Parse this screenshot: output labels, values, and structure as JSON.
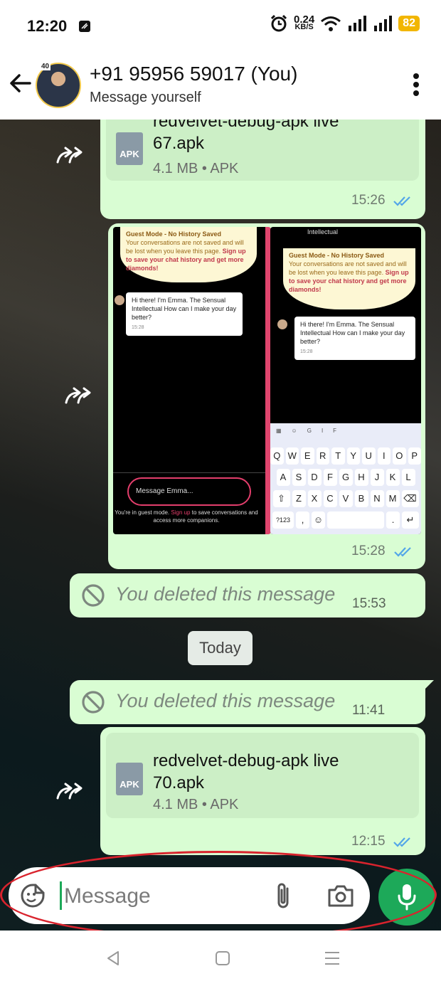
{
  "status_bar": {
    "time": "12:20",
    "net_speed_value": "0.24",
    "net_speed_unit": "KB/S",
    "battery": "82"
  },
  "header": {
    "title": "+91 95956 59017 (You)",
    "subtitle": "Message yourself",
    "avatar_badge": "40"
  },
  "messages": {
    "file1": {
      "name_line1": "redvelvet-debug-apk live",
      "name_line2": "67.apk",
      "meta": "4.1 MB • APK",
      "icon_label": "APK",
      "time": "15:26"
    },
    "images": {
      "time": "15:28",
      "left": {
        "guest_title": "Guest Mode - No History Saved",
        "guest_text": "Your conversations are not saved and will be lost when you leave this page.",
        "guest_signup": "Sign up to save your chat history and get more diamonds!",
        "msg": "Hi there! I'm Emma. The Sensual Intellectual How can I make your day better?",
        "msg_time": "15:28",
        "input_placeholder": "Message Emma...",
        "footer_a": "You're in guest mode.",
        "footer_link": "Sign up",
        "footer_b": "to save conversations and access more companions."
      },
      "right": {
        "top_text": "Intellectual",
        "guest_title": "Guest Mode - No History Saved",
        "guest_text": "Your conversations are not saved and will be lost when you leave this page.",
        "guest_signup": "Sign up to save your chat history and get more diamonds!",
        "msg": "Hi there! I'm Emma. The Sensual Intellectual How can I make your day better?",
        "msg_time": "15:28",
        "keyboard_row1": [
          "Q",
          "W",
          "E",
          "R",
          "T",
          "Y",
          "U",
          "I",
          "O",
          "P"
        ],
        "keyboard_row2": [
          "A",
          "S",
          "D",
          "F",
          "G",
          "H",
          "J",
          "K",
          "L"
        ],
        "keyboard_row3": [
          "Z",
          "X",
          "C",
          "V",
          "B",
          "N",
          "M"
        ],
        "key_numbers": "?123",
        "key_comma": ",",
        "key_period": ".",
        "key_gif": "GIF"
      }
    },
    "deleted1": {
      "text": "You deleted this message",
      "time": "15:53"
    },
    "date_chip": "Today",
    "deleted2": {
      "text": "You deleted this message",
      "time": "11:41"
    },
    "file2": {
      "name_line1": "redvelvet-debug-apk live",
      "name_line2": "70.apk",
      "meta": "4.1 MB • APK",
      "icon_label": "APK",
      "time": "12:15"
    }
  },
  "composer": {
    "placeholder": "Message"
  },
  "colors": {
    "bubble": "#d9fdd3",
    "accent_green": "#1da959",
    "read_ticks": "#53a6e8",
    "highlight_ellipse": "#d9232d"
  }
}
